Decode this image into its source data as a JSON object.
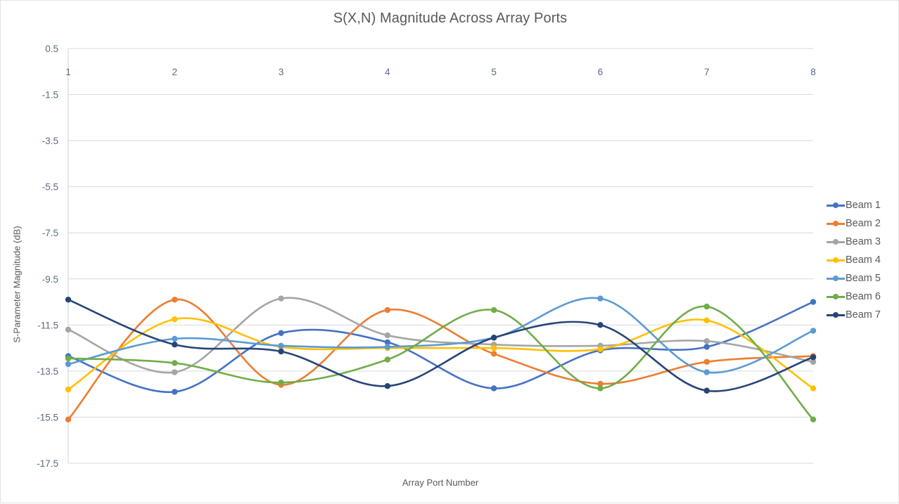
{
  "chart_data": {
    "type": "line",
    "title": "S(X,N) Magnitude Across Array Ports",
    "xlabel": "Array Port Number",
    "ylabel": "S-Parameter Magnitude (dB)",
    "categories": [
      1,
      2,
      3,
      4,
      5,
      6,
      7,
      8
    ],
    "x_tick_labels": [
      "1",
      "2",
      "3",
      "4",
      "5",
      "6",
      "7",
      "8"
    ],
    "y_tick_labels": [
      "0.5",
      "-1.5",
      "-3.5",
      "-5.5",
      "-7.5",
      "-9.5",
      "-11.5",
      "-13.5",
      "-15.5",
      "-17.5"
    ],
    "y_ticks": [
      0.5,
      -1.5,
      -3.5,
      -5.5,
      -7.5,
      -9.5,
      -11.5,
      -13.5,
      -15.5,
      -17.5
    ],
    "ylim": [
      -17.5,
      0.5
    ],
    "xlim": [
      1,
      8
    ],
    "grid": "horizontal",
    "smooth": true,
    "markers": true,
    "legend_position": "right",
    "series": [
      {
        "name": "Beam 1",
        "color": "#4472C4",
        "values": [
          -12.85,
          -14.4,
          -11.85,
          -12.25,
          -14.25,
          -12.6,
          -12.45,
          -10.5
        ]
      },
      {
        "name": "Beam 2",
        "color": "#ED7D31",
        "values": [
          -15.6,
          -10.4,
          -14.1,
          -10.85,
          -12.75,
          -14.05,
          -13.1,
          -12.85
        ]
      },
      {
        "name": "Beam 3",
        "color": "#A5A5A5",
        "values": [
          -11.7,
          -13.55,
          -10.35,
          -11.95,
          -12.35,
          -12.4,
          -12.2,
          -13.1
        ]
      },
      {
        "name": "Beam 4",
        "color": "#FFC000",
        "values": [
          -14.3,
          -11.25,
          -12.45,
          -12.5,
          -12.5,
          -12.55,
          -11.3,
          -14.25
        ]
      },
      {
        "name": "Beam 5",
        "color": "#5B9BD5",
        "values": [
          -13.2,
          -12.1,
          -12.4,
          -12.45,
          -12.05,
          -10.35,
          -13.55,
          -11.75
        ]
      },
      {
        "name": "Beam 6",
        "color": "#70AD47",
        "values": [
          -12.95,
          -13.15,
          -14.0,
          -13.0,
          -10.85,
          -14.25,
          -10.7,
          -15.6
        ]
      },
      {
        "name": "Beam 7",
        "color": "#264478",
        "values": [
          -10.4,
          -12.35,
          -12.65,
          -14.15,
          -12.05,
          -11.5,
          -14.35,
          -12.9
        ]
      }
    ]
  },
  "legend": {
    "items": [
      {
        "label": "Beam 1"
      },
      {
        "label": "Beam 2"
      },
      {
        "label": "Beam 3"
      },
      {
        "label": "Beam 4"
      },
      {
        "label": "Beam 5"
      },
      {
        "label": "Beam 6"
      },
      {
        "label": "Beam 7"
      }
    ]
  }
}
